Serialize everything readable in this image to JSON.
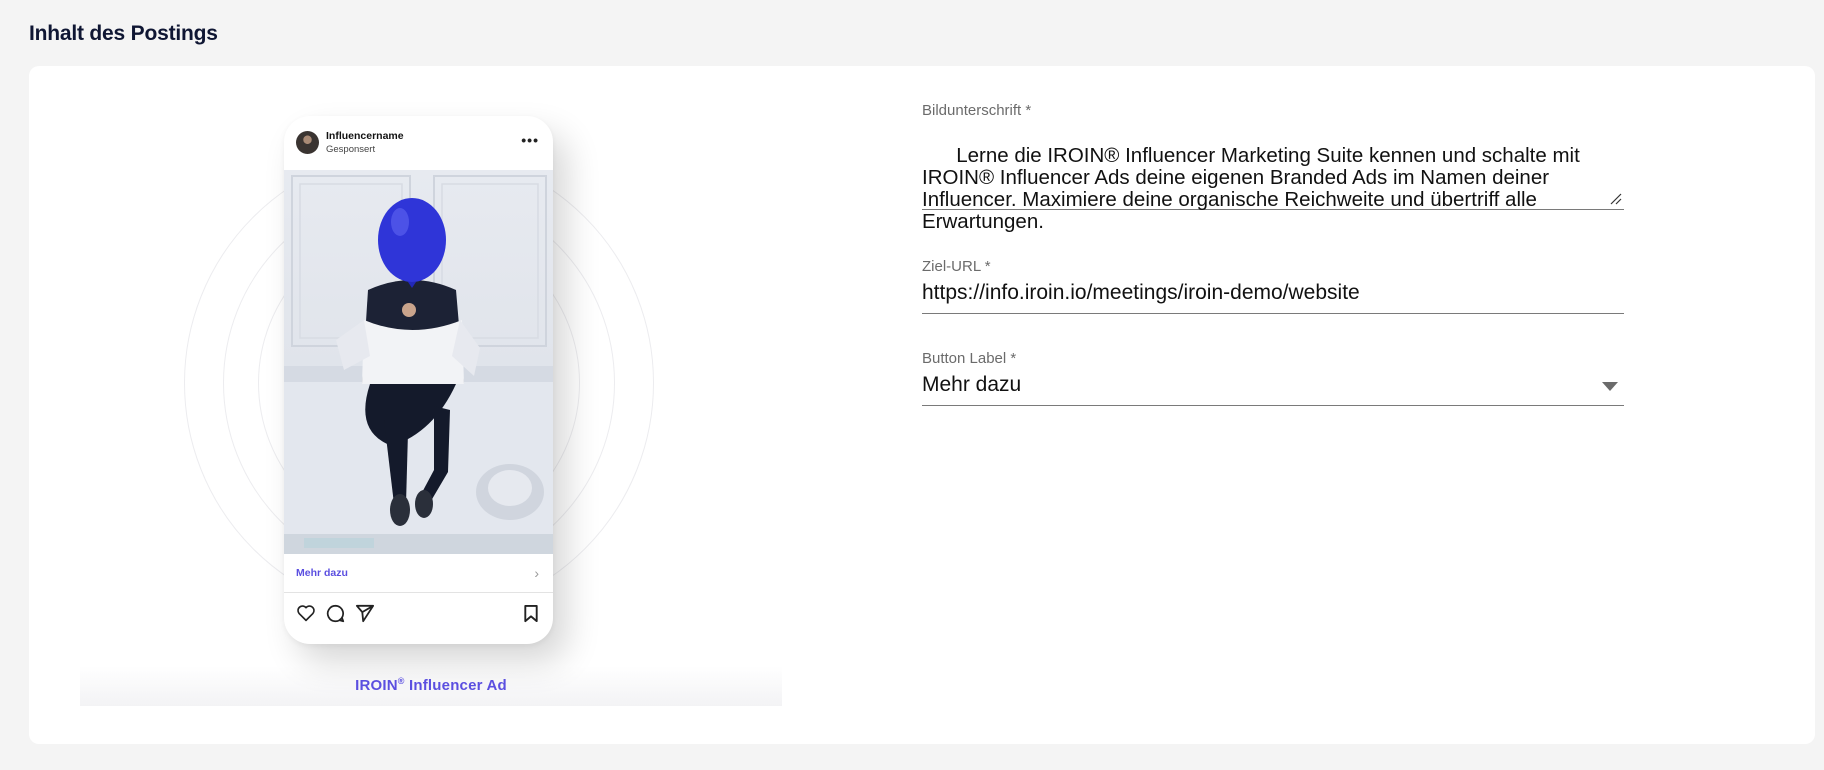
{
  "page": {
    "section_title": "Inhalt des Postings"
  },
  "preview": {
    "influencer_name": "Influencername",
    "sponsored_label": "Gesponsert",
    "more_icon": "more-dots-icon",
    "cta_label": "Mehr dazu",
    "cta_icon": "chevron-right-icon",
    "action_icons": [
      "heart-icon",
      "comment-icon",
      "send-icon",
      "bookmark-icon"
    ],
    "brand_name": "IROIN",
    "brand_mark": "®",
    "brand_suffix": " Influencer Ad",
    "accent_color": "#5b4fe0"
  },
  "form": {
    "caption": {
      "label": "Bildunterschrift *",
      "value": "Lerne die IROIN® Influencer Marketing Suite kennen und schalte mit IROIN® Influencer Ads deine eigenen Branded Ads im Namen deiner Influencer. Maximiere deine organische Reichweite und übertriff alle Erwartungen."
    },
    "target_url": {
      "label": "Ziel-URL *",
      "value": "https://info.iroin.io/meetings/iroin-demo/website"
    },
    "button_label": {
      "label": "Button Label *",
      "value": "Mehr dazu"
    }
  }
}
